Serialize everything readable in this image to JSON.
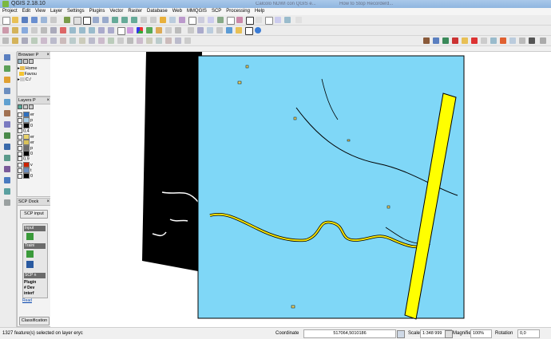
{
  "window": {
    "title": "QGIS 2.18.10"
  },
  "ghost_tabs": [
    "Calcolo NDWI con QGIS e...",
    "How to Stop Recorderd..."
  ],
  "menubar": [
    "Project",
    "Edit",
    "View",
    "Layer",
    "Settings",
    "Plugins",
    "Vector",
    "Raster",
    "Database",
    "Web",
    "MMQGIS",
    "SCP",
    "Processing",
    "Help"
  ],
  "browser": {
    "title": "Browser P",
    "items": [
      "Home",
      "Favou",
      "C:/"
    ]
  },
  "layers": {
    "title": "Layers P",
    "items": [
      {
        "label": "er",
        "color": "#2e6fbf"
      },
      {
        "label": "p",
        "color": "#a6cde8"
      },
      {
        "label": "0",
        "color": "#000000"
      },
      {
        "label": "0,4",
        "color": ""
      },
      {
        "label": "er",
        "color": "#e9d46b"
      },
      {
        "label": "er",
        "color": "#d9c25a"
      },
      {
        "label": "p",
        "color": "#6b6b6b"
      },
      {
        "label": "0",
        "color": "#000000"
      },
      {
        "label": "0,9",
        "color": ""
      },
      {
        "label": "v",
        "color": "#cc2200"
      },
      {
        "label": "t",
        "color": "#6c8ebf"
      },
      {
        "label": "0",
        "color": "#000000"
      }
    ]
  },
  "scp_dock": {
    "title": "SCP Dock",
    "input_button": "SCP input",
    "tabs": [
      "Input",
      "Traini",
      "SCP n"
    ],
    "plugin_label": "Plugin",
    "texts": [
      "# Dev",
      "interf",
      "Read"
    ],
    "classification_button": "Classification"
  },
  "colors": {
    "water": "#7fd7f7",
    "river": "#f5e400",
    "strip": "#ffff00",
    "canvas_bg": "#ffffff"
  },
  "status": {
    "message": "1327 feature(s) selected on layer eryc",
    "coordinate_label": "Coordinate",
    "coordinate_value": "517064,5010186",
    "scale_label": "Scale",
    "scale_value": "1:348 999",
    "magnifier_label": "Magnifier",
    "magnifier_value": "100%",
    "rotation_label": "Rotation",
    "rotation_value": "0,0"
  }
}
